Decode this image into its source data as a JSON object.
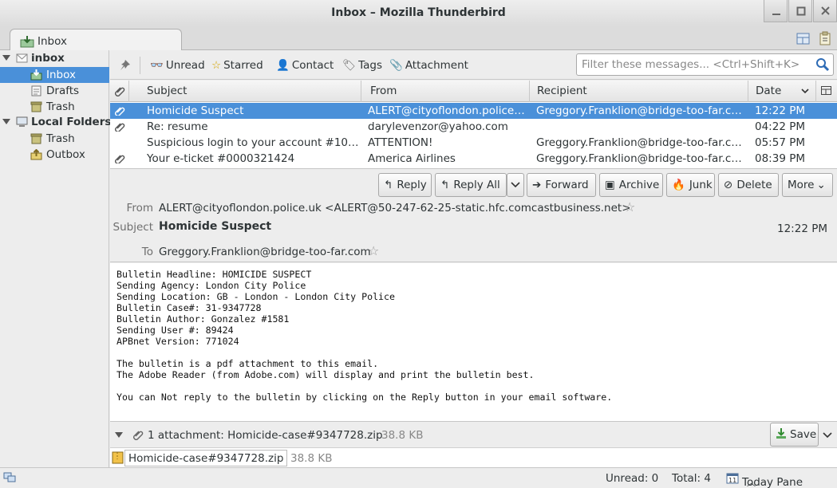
{
  "window": {
    "title": "Inbox – Mozilla Thunderbird"
  },
  "tab": {
    "label": "Inbox"
  },
  "folders": [
    {
      "label": "inbox",
      "type": "account"
    },
    {
      "label": "Inbox",
      "type": "folder",
      "selected": true
    },
    {
      "label": "Drafts",
      "type": "folder"
    },
    {
      "label": "Trash",
      "type": "folder"
    },
    {
      "label": "Local Folders",
      "type": "account"
    },
    {
      "label": "Trash",
      "type": "folder"
    },
    {
      "label": "Outbox",
      "type": "folder"
    }
  ],
  "quickfilter": {
    "unread": "Unread",
    "starred": "Starred",
    "contact": "Contact",
    "tags": "Tags",
    "attachment": "Attachment",
    "placeholder": "Filter these messages... <Ctrl+Shift+K>"
  },
  "columns": {
    "subject": "Subject",
    "from": "From",
    "recipient": "Recipient",
    "date": "Date"
  },
  "messages": [
    {
      "subject": "Homicide Suspect",
      "from": "ALERT@cityoflondon.police.uk",
      "recipient": "Greggory.Franklion@bridge-too-far.com",
      "date": "12:22 PM",
      "attachment": true,
      "selected": true
    },
    {
      "subject": "Re: resume",
      "from": "darylevenzor@yahoo.com",
      "recipient": "",
      "date": "04:22 PM",
      "attachment": true,
      "selected": false
    },
    {
      "subject": "Suspicious login to your account #109...",
      "from": "ATTENTION!",
      "recipient": "Greggory.Franklion@bridge-too-far.com",
      "date": "05:57 PM",
      "attachment": false,
      "selected": false
    },
    {
      "subject": "Your e-ticket #0000321424",
      "from": "America Airlines",
      "recipient": "Greggory.Franklion@bridge-too-far.com",
      "date": "08:39 PM",
      "attachment": true,
      "selected": false
    }
  ],
  "header_buttons": {
    "reply": "Reply",
    "reply_all": "Reply All",
    "forward": "Forward",
    "archive": "Archive",
    "junk": "Junk",
    "delete": "Delete",
    "more": "More"
  },
  "message": {
    "from_label": "From",
    "from": "ALERT@cityoflondon.police.uk <ALERT@50-247-62-25-static.hfc.comcastbusiness.net>",
    "subject_label": "Subject",
    "subject": "Homicide Suspect",
    "date": "12:22 PM",
    "to_label": "To",
    "to": "Greggory.Franklion@bridge-too-far.com",
    "body": [
      "Bulletin Headline: HOMICIDE SUSPECT",
      "Sending Agency: London City Police",
      "Sending Location: GB - London - London City Police",
      "Bulletin Case#: 31-9347728",
      "Bulletin Author: Gonzalez #1581",
      "Sending User #: 89424",
      "APBnet Version: 771024",
      "",
      "The bulletin is a pdf attachment to this email.",
      "The Adobe Reader (from Adobe.com) will display and print the bulletin best.",
      "",
      "You can Not reply to the bulletin by clicking on the Reply button in your email software."
    ]
  },
  "attachments": {
    "summary": "1 attachment: Homicide-case#9347728.zip",
    "summary_size": "38.8 KB",
    "save": "Save",
    "items": [
      {
        "name": "Homicide-case#9347728.zip",
        "size": "38.8 KB"
      }
    ]
  },
  "status": {
    "unread": "Unread: 0",
    "total": "Total: 4",
    "today_pane": "Today Pane"
  },
  "colors": {
    "selection": "#4a90d9"
  }
}
